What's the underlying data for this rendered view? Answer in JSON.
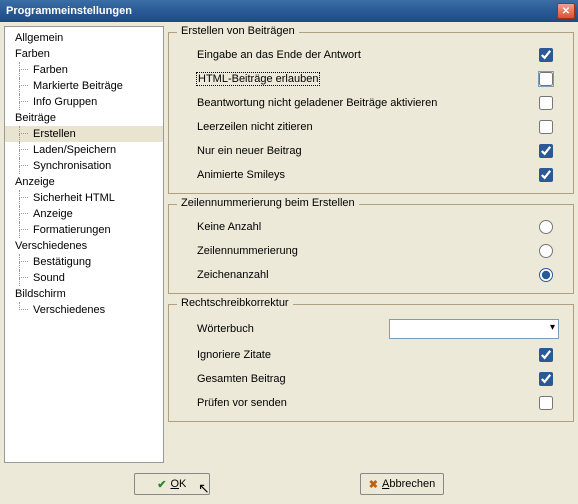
{
  "window": {
    "title": "Programmeinstellungen"
  },
  "sidebar": {
    "items": [
      {
        "label": "Allgemein",
        "level": 0
      },
      {
        "label": "Farben",
        "level": 0
      },
      {
        "label": "Farben",
        "level": 1
      },
      {
        "label": "Markierte Beiträge",
        "level": 1
      },
      {
        "label": "Info Gruppen",
        "level": 1
      },
      {
        "label": "Beiträge",
        "level": 0
      },
      {
        "label": "Erstellen",
        "level": 1,
        "selected": true
      },
      {
        "label": "Laden/Speichern",
        "level": 1
      },
      {
        "label": "Synchronisation",
        "level": 1
      },
      {
        "label": "Anzeige",
        "level": 0
      },
      {
        "label": "Sicherheit HTML",
        "level": 1
      },
      {
        "label": "Anzeige",
        "level": 1
      },
      {
        "label": "Formatierungen",
        "level": 1
      },
      {
        "label": "Verschiedenes",
        "level": 0
      },
      {
        "label": "Bestätigung",
        "level": 1
      },
      {
        "label": "Sound",
        "level": 1
      },
      {
        "label": "Bildschirm",
        "level": 0
      },
      {
        "label": "Verschiedenes",
        "level": 1
      }
    ]
  },
  "groups": {
    "create": {
      "title": "Erstellen von Beiträgen",
      "options": [
        {
          "label": "Eingabe an das Ende der Antwort",
          "checked": true
        },
        {
          "label": "HTML-Beiträge erlauben",
          "checked": false,
          "focused": true,
          "highlight": true
        },
        {
          "label": "Beantwortung nicht geladener Beiträge aktivieren",
          "checked": false
        },
        {
          "label": "Leerzeilen nicht zitieren",
          "checked": false
        },
        {
          "label": "Nur ein neuer Beitrag",
          "checked": true
        },
        {
          "label": "Animierte Smileys",
          "checked": true
        }
      ]
    },
    "numbering": {
      "title": "Zeilennummerierung beim Erstellen",
      "options": [
        {
          "label": "Keine Anzahl",
          "checked": false
        },
        {
          "label": "Zeilennummerierung",
          "checked": false
        },
        {
          "label": "Zeichenanzahl",
          "checked": true
        }
      ]
    },
    "spell": {
      "title": "Rechtschreibkorrektur",
      "dict_label": "Wörterbuch",
      "dict_value": "",
      "options": [
        {
          "label": "Ignoriere Zitate",
          "checked": true
        },
        {
          "label": "Gesamten Beitrag",
          "checked": true
        },
        {
          "label": "Prüfen vor senden",
          "checked": false
        }
      ]
    }
  },
  "buttons": {
    "ok": "OK",
    "cancel": "Abbrechen"
  }
}
